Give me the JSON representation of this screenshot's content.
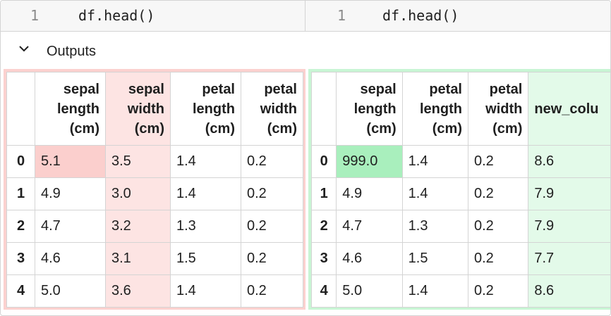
{
  "code": {
    "left": {
      "line_number": "1",
      "source": "df.head()"
    },
    "right": {
      "line_number": "1",
      "source": "df.head()"
    }
  },
  "outputs": {
    "label": "Outputs"
  },
  "left_table": {
    "columns": [
      "sepal\nlength\n(cm)",
      "sepal\nwidth\n(cm)",
      "petal\nlength\n(cm)",
      "petal\nwidth\n(cm)"
    ],
    "index": [
      "0",
      "1",
      "2",
      "3",
      "4"
    ],
    "rows": [
      [
        "5.1",
        "3.5",
        "1.4",
        "0.2"
      ],
      [
        "4.9",
        "3.0",
        "1.4",
        "0.2"
      ],
      [
        "4.7",
        "3.2",
        "1.3",
        "0.2"
      ],
      [
        "4.6",
        "3.1",
        "1.5",
        "0.2"
      ],
      [
        "5.0",
        "3.6",
        "1.4",
        "0.2"
      ]
    ]
  },
  "right_table": {
    "columns": [
      "sepal\nlength\n(cm)",
      "petal\nlength\n(cm)",
      "petal\nwidth\n(cm)",
      "new_colu"
    ],
    "index": [
      "0",
      "1",
      "2",
      "3",
      "4"
    ],
    "rows": [
      [
        "999.0",
        "1.4",
        "0.2",
        "8.6"
      ],
      [
        "4.9",
        "1.4",
        "0.2",
        "7.9"
      ],
      [
        "4.7",
        "1.3",
        "0.2",
        "7.9"
      ],
      [
        "4.6",
        "1.5",
        "0.2",
        "7.7"
      ],
      [
        "5.0",
        "1.4",
        "0.2",
        "8.6"
      ]
    ]
  },
  "colors": {
    "removed_pane": "#fbd1cf",
    "removed_column": "#fde4e3",
    "removed_cell": "#fbcfcd",
    "added_pane": "#c8f5d4",
    "added_column": "#e3fae9",
    "added_cell": "#a9efbd"
  },
  "icons": {
    "outputs_toggle": "chevron-down-icon"
  }
}
